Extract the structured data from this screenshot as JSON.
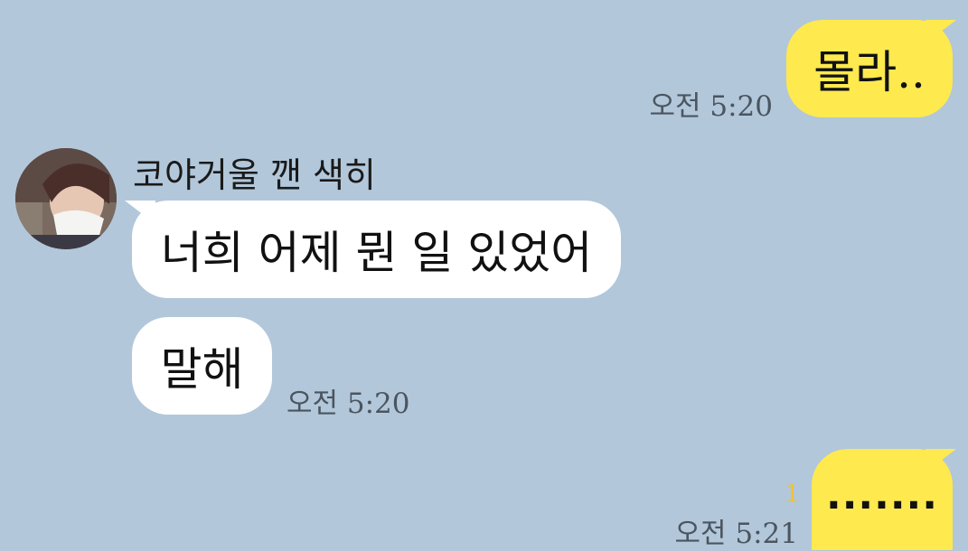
{
  "colors": {
    "background": "#b2c7da",
    "my_bubble": "#fee94e",
    "their_bubble": "#ffffff",
    "timestamp": "#4a5560",
    "unread_count": "#f1c232"
  },
  "messages": {
    "m1": {
      "text": "몰라..",
      "time": "오전 5:20"
    },
    "sender": {
      "name": "코야거울 깬 색히",
      "avatar_icon": "profile-photo"
    },
    "m2": {
      "text": "너희 어제 뭔 일 있었어"
    },
    "m3": {
      "text": "말해",
      "time": "오전 5:20"
    },
    "m4": {
      "text": ".......",
      "time": "오전 5:21",
      "unread": "1"
    }
  }
}
